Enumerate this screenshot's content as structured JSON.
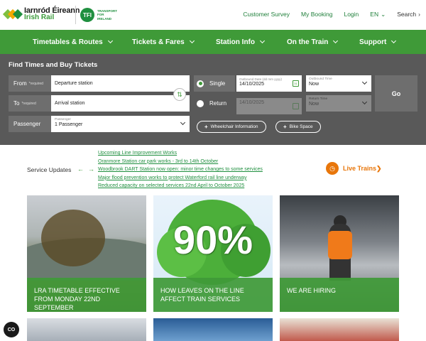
{
  "header": {
    "logo_line1": "Iarnród Éireann",
    "logo_line2": "Irish Rail",
    "tfi_badge": "TFI",
    "tfi_text": "TRANSPORT FOR IRELAND",
    "links": [
      "Customer Survey",
      "My Booking",
      "Login",
      "EN"
    ],
    "search_label": "Search"
  },
  "nav": {
    "items": [
      "Timetables & Routes",
      "Tickets & Fares",
      "Station Info",
      "On the Train",
      "Support"
    ]
  },
  "planner": {
    "title": "Find Times and Buy Tickets",
    "from_label": "From",
    "to_label": "To",
    "required": "*required",
    "from_value": "Departure station",
    "to_value": "Arrival station",
    "passenger_label": "Passenger",
    "passenger_caption": "Passenger",
    "passenger_value": "1 Passenger",
    "single_label": "Single",
    "return_label": "Return",
    "outbound_date_caption": "Outbound Date (dd mm yyyy)",
    "outbound_date": "14/10/2025",
    "return_date": "14/10/2025",
    "outbound_time_caption": "Outbound Time",
    "outbound_time": "Now",
    "return_time_caption": "Return Time",
    "return_time": "Now",
    "calendar_day": "31",
    "go_label": "Go",
    "wheelchair_label": "Wheelchair Information",
    "bike_label": "Bike Space"
  },
  "service_updates": {
    "label": "Service Updates",
    "items": [
      "Upcoming Line Improvement Works",
      "Oranmore Station car park works - 3rd to 14th October",
      "Woodbrook DART Station now open: minor time changes to some services",
      "Major flood prevention works to protect Waterford rail line underway",
      "Reduced capacity on selected services 22nd April to October 2025"
    ],
    "live_trains": "Live Trains❯"
  },
  "cards": [
    {
      "caption": "LRA TIMETABLE EFFECTIVE FROM MONDAY 22ND SEPTEMBER"
    },
    {
      "caption": "HOW LEAVES ON THE LINE AFFECT TRAIN SERVICES",
      "image_text": "90%"
    },
    {
      "caption": "WE ARE HIRING"
    }
  ],
  "cookie_label": "CO",
  "colors": {
    "brand_green": "#3f9a38",
    "planner_bg": "#595959",
    "live_orange": "#e8760a"
  }
}
